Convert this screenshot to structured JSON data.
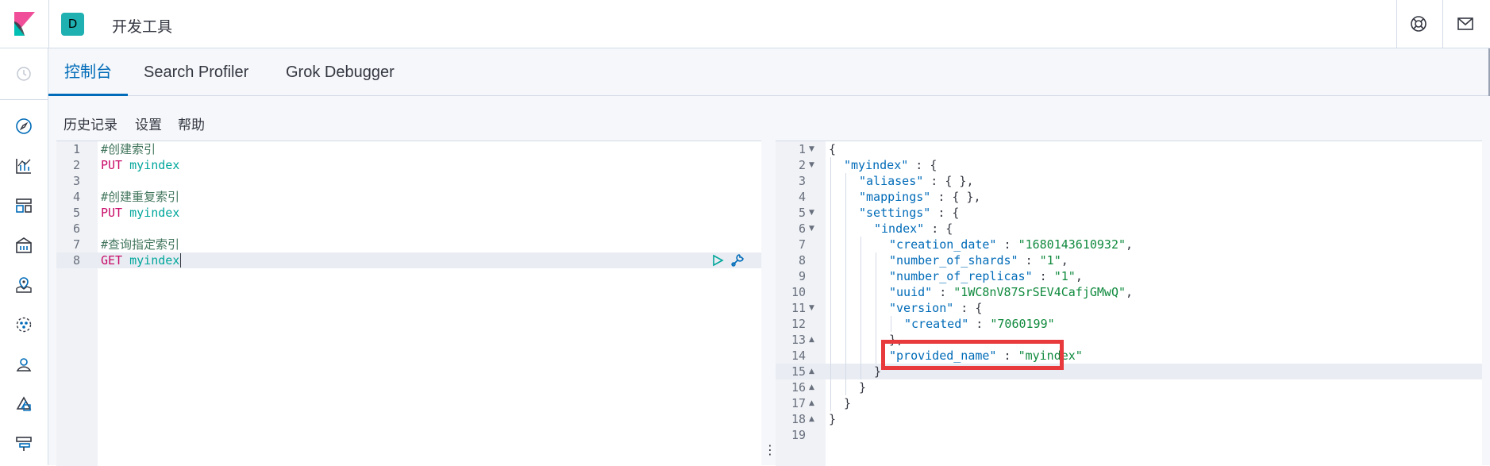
{
  "header": {
    "space_initial": "D",
    "app_title": "开发工具",
    "icons": [
      "kibana-logo-icon",
      "help-icon",
      "mail-icon"
    ]
  },
  "sidenav": {
    "icons": [
      "recently-viewed-clock-icon",
      "discover-compass-icon",
      "visualize-chart-icon",
      "dashboard-icon",
      "canvas-icon",
      "maps-icon",
      "ml-icon",
      "metrics-icon",
      "apm-icon",
      "uptime-icon"
    ]
  },
  "tabs": [
    {
      "label": "控制台",
      "active": true
    },
    {
      "label": "Search Profiler",
      "active": false
    },
    {
      "label": "Grok Debugger",
      "active": false
    }
  ],
  "toolbar": {
    "history": "历史记录",
    "settings": "设置",
    "help": "帮助"
  },
  "editor": {
    "line_numbers": [
      "1",
      "2",
      "3",
      "4",
      "5",
      "6",
      "7",
      "8"
    ],
    "lines": [
      {
        "comment": "#创建索引"
      },
      {
        "method": "PUT",
        "path": "myindex"
      },
      {},
      {
        "comment": "#创建重复索引"
      },
      {
        "method": "PUT",
        "path": "myindex"
      },
      {},
      {
        "comment": "#查询指定索引"
      },
      {
        "method": "GET",
        "path": "myindex"
      }
    ],
    "active_line": 8
  },
  "output": {
    "line_numbers": [
      "1",
      "2",
      "3",
      "4",
      "5",
      "6",
      "7",
      "8",
      "9",
      "10",
      "11",
      "12",
      "13",
      "14",
      "15",
      "16",
      "17",
      "18",
      "19"
    ],
    "active_line": 15,
    "l1": "{",
    "l2_key": "\"myindex\"",
    "l2_rest": " : {",
    "l3_key": "\"aliases\"",
    "l3_rest": " : { },",
    "l4_key": "\"mappings\"",
    "l4_rest": " : { },",
    "l5_key": "\"settings\"",
    "l5_rest": " : {",
    "l6_key": "\"index\"",
    "l6_rest": " : {",
    "l7_key": "\"creation_date\"",
    "l7_sep": " : ",
    "l7_val": "\"1680143610932\"",
    "l7_end": ",",
    "l8_key": "\"number_of_shards\"",
    "l8_sep": " : ",
    "l8_val": "\"1\"",
    "l8_end": ",",
    "l9_key": "\"number_of_replicas\"",
    "l9_sep": " : ",
    "l9_val": "\"1\"",
    "l9_end": ",",
    "l10_key": "\"uuid\"",
    "l10_sep": " : ",
    "l10_val": "\"1WC8nV87SrSEV4CafjGMwQ\"",
    "l10_end": ",",
    "l11_key": "\"version\"",
    "l11_rest": " : {",
    "l12_key": "\"created\"",
    "l12_sep": " : ",
    "l12_val": "\"7060199\"",
    "l13": "},",
    "l14_key": "\"provided_name\"",
    "l14_sep": " : ",
    "l14_val": "\"myindex\"",
    "l15": "}",
    "l16": "}",
    "l17": "}",
    "l18": "}"
  },
  "colors": {
    "accent": "#006bb8",
    "highlight_box": "#e8393c",
    "space_badge": "#1fb0b2"
  }
}
